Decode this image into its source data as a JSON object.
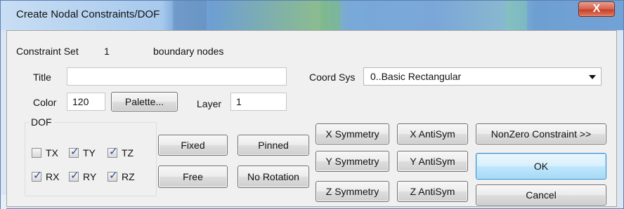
{
  "window": {
    "title": "Create Nodal Constraints/DOF",
    "close_glyph": "X"
  },
  "constraint": {
    "set_label": "Constraint Set",
    "set_value": "1",
    "set_name": "boundary nodes"
  },
  "fields": {
    "title_label": "Title",
    "title_value": "",
    "color_label": "Color",
    "color_value": "120",
    "palette_label": "Palette...",
    "layer_label": "Layer",
    "layer_value": "1",
    "coord_label": "Coord Sys",
    "coord_value": "0..Basic Rectangular"
  },
  "dof": {
    "group_label": "DOF",
    "items": [
      {
        "label": "TX",
        "checked": false
      },
      {
        "label": "TY",
        "checked": true
      },
      {
        "label": "TZ",
        "checked": true
      },
      {
        "label": "RX",
        "checked": true
      },
      {
        "label": "RY",
        "checked": true
      },
      {
        "label": "RZ",
        "checked": true
      }
    ]
  },
  "buttons": {
    "fixed": "Fixed",
    "pinned": "Pinned",
    "free": "Free",
    "no_rotation": "No Rotation",
    "x_symmetry": "X Symmetry",
    "x_antisym": "X AntiSym",
    "y_symmetry": "Y Symmetry",
    "y_antisym": "Y AntiSym",
    "z_symmetry": "Z Symmetry",
    "z_antisym": "Z AntiSym",
    "nonzero": "NonZero Constraint >>",
    "ok": "OK",
    "cancel": "Cancel"
  },
  "icons": {
    "close": "close-icon",
    "dropdown": "chevron-down-icon",
    "checkmark": "checkmark-icon"
  },
  "colors": {
    "title_bar": "#7aa8d8",
    "dialog_face": "#f0f0f0",
    "default_button": "#bee6fd",
    "close_button": "#d45d47"
  }
}
